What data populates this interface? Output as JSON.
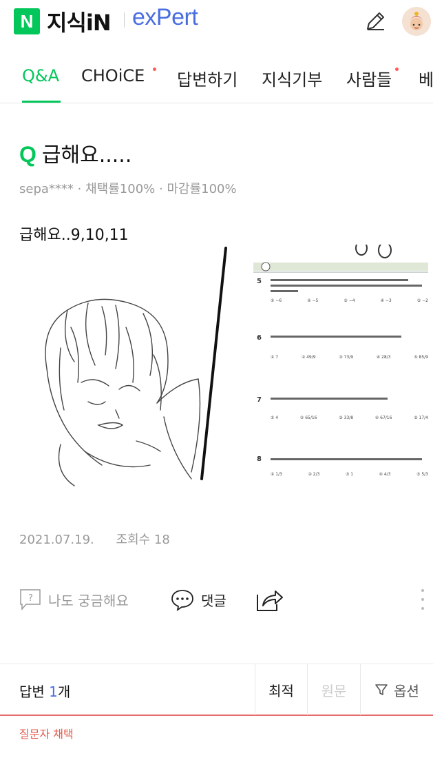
{
  "header": {
    "logo_letter": "N",
    "brand": "지식iN",
    "expert": "exPert",
    "icons": [
      "pencil-icon",
      "profile-avatar"
    ]
  },
  "tabs": [
    {
      "label": "Q&A",
      "active": true,
      "dot": false
    },
    {
      "label": "CHOiCE",
      "active": false,
      "dot": true
    },
    {
      "label": "답변하기",
      "active": false,
      "dot": false
    },
    {
      "label": "지식기부",
      "active": false,
      "dot": false
    },
    {
      "label": "사람들",
      "active": false,
      "dot": true
    },
    {
      "label": "베",
      "active": false,
      "dot": false
    }
  ],
  "question": {
    "q_mark": "Q",
    "title": "급해요.....",
    "author": "sepa****",
    "adopt_rate": "채택률100%",
    "close_rate": "마감률100%",
    "body": "급해요..9,10,11"
  },
  "photo": {
    "problems": [
      {
        "num": "5",
        "choices": [
          "① −6",
          "② −5",
          "③ −4",
          "④ −3",
          "⑤ −2"
        ]
      },
      {
        "num": "6",
        "choices": [
          "① 7",
          "② 49/9",
          "③ 73/9",
          "④ 28/3",
          "⑤ 85/9"
        ]
      },
      {
        "num": "7",
        "choices": [
          "① 4",
          "② 65/16",
          "③ 33/8",
          "④ 67/16",
          "⑤ 17/4"
        ]
      },
      {
        "num": "8",
        "choices": [
          "① 1/3",
          "② 2/3",
          "③ 1",
          "④ 4/3",
          "⑤ 5/3"
        ]
      }
    ]
  },
  "info": {
    "date": "2021.07.19.",
    "views": "조회수 18"
  },
  "actions": {
    "curious": "나도 궁금해요",
    "comment": "댓글",
    "share_icon": "share-icon",
    "more_icon": "more-vertical-icon"
  },
  "answers": {
    "label": "답변",
    "count": "1",
    "unit": "개",
    "sort_latest": "최적",
    "sort_original": "원문",
    "option": "옵션",
    "chosen_label": "질문자 채택"
  },
  "colors": {
    "naver_green": "#03c75a",
    "expert_blue": "#4a6ee0",
    "chosen_red": "#e25b4d"
  }
}
